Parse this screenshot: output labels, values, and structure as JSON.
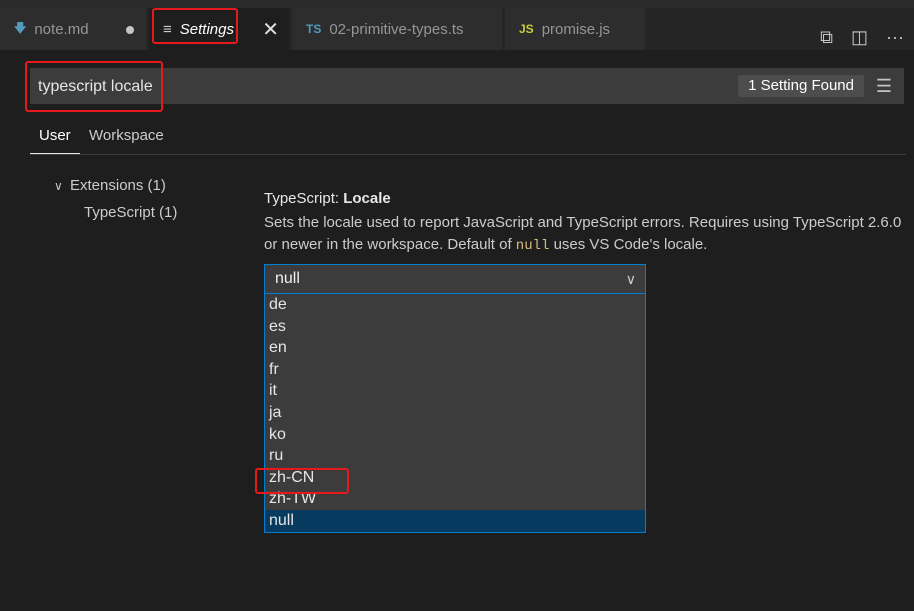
{
  "tabs": [
    {
      "icon": "markdown-icon",
      "glyph": "🡇",
      "label": "note.md",
      "dirty": true
    },
    {
      "icon": "settings-icon",
      "glyph": "≡",
      "label": "Settings",
      "active": true
    },
    {
      "icon": "typescript-icon",
      "glyph": "TS",
      "label": "02-primitive-types.ts"
    },
    {
      "icon": "javascript-icon",
      "glyph": "JS",
      "label": "promise.js"
    }
  ],
  "actions": [
    "open-settings-json-icon",
    "split-editor-icon",
    "more-actions-icon"
  ],
  "search": {
    "value": "typescript locale",
    "found": "1 Setting Found"
  },
  "scopes": {
    "user": "User",
    "workspace": "Workspace"
  },
  "toc": {
    "extensions": "Extensions (1)",
    "typescript": "TypeScript (1)"
  },
  "setting": {
    "category": "TypeScript: ",
    "name": "Locale",
    "desc_1": "Sets the locale used to report JavaScript and TypeScript errors. Requires using TypeScript 2.6.0 or newer in the workspace. Default of ",
    "desc_code": "null",
    "desc_2": " uses VS Code's locale.",
    "value": "null",
    "options": [
      "de",
      "es",
      "en",
      "fr",
      "it",
      "ja",
      "ko",
      "ru",
      "zh-CN",
      "zh-TW",
      "null"
    ],
    "selected": "null"
  },
  "colors": {
    "highlight": "#e51a1a",
    "focus": "#007fd4",
    "selected": "#063b5f"
  }
}
